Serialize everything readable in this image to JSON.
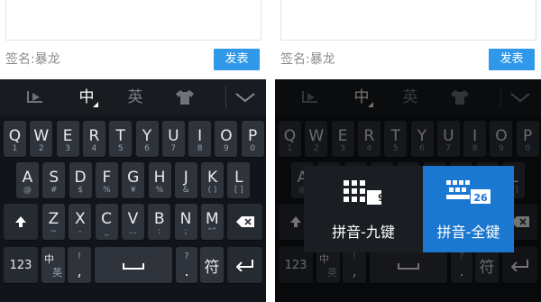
{
  "compose": {
    "signature": "签名:暴龙",
    "publish_label": "发表"
  },
  "toolbar": {
    "chinese_label": "中",
    "english_label": "英"
  },
  "rows": [
    [
      {
        "m": "Q",
        "s": "1"
      },
      {
        "m": "W",
        "s": "2"
      },
      {
        "m": "E",
        "s": "3"
      },
      {
        "m": "R",
        "s": "4"
      },
      {
        "m": "T",
        "s": "5"
      },
      {
        "m": "Y",
        "s": "6"
      },
      {
        "m": "U",
        "s": "7"
      },
      {
        "m": "I",
        "s": "8"
      },
      {
        "m": "O",
        "s": "9"
      },
      {
        "m": "P",
        "s": "0"
      }
    ],
    [
      {
        "m": "A",
        "s": "@"
      },
      {
        "m": "S",
        "s": "#"
      },
      {
        "m": "D",
        "s": "$"
      },
      {
        "m": "F",
        "s": "%"
      },
      {
        "m": "G",
        "s": "¥"
      },
      {
        "m": "H",
        "s": "%"
      },
      {
        "m": "J",
        "s": "&"
      },
      {
        "m": "K",
        "s": "( )"
      },
      {
        "m": "L",
        "s": "[ ]"
      }
    ],
    [
      {
        "m": "Z",
        "s": "~"
      },
      {
        "m": "X",
        "s": "-"
      },
      {
        "m": "C",
        "s": "_"
      },
      {
        "m": "V",
        "s": "…"
      },
      {
        "m": "B",
        "s": ":"
      },
      {
        "m": "N",
        "s": ";"
      },
      {
        "m": "M",
        "s": "“”"
      }
    ]
  ],
  "bottom": {
    "num_label": "123",
    "zh_top": "中",
    "zh_bottom": "英",
    "comma": ",",
    "comma_sub": "!",
    "period": ".",
    "period_sub": "?",
    "symbol": "符"
  },
  "layout_popup": {
    "nine_label": "拼音-九键",
    "nine_badge": "9",
    "full_label": "拼音-全键",
    "full_badge": "26"
  },
  "colors": {
    "accent": "#2f98e8",
    "keyboard_bg": "#1a1e24",
    "key_bg": "#2f343c"
  }
}
